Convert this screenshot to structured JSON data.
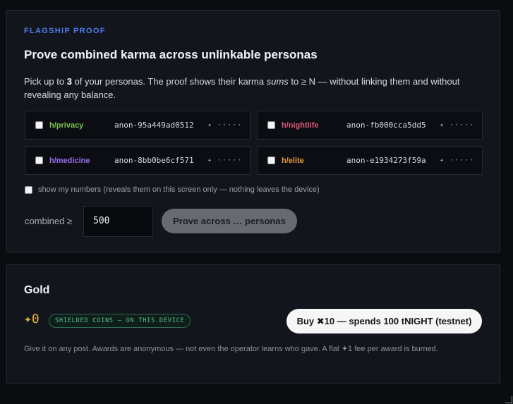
{
  "proof": {
    "eyebrow": "FLAGSHIP PROOF",
    "title": "Prove combined karma across unlinkable personas",
    "desc_before_count": "Pick up to ",
    "desc_count": "3",
    "desc_mid": " of your personas. The proof shows their karma ",
    "desc_sums": "sums",
    "desc_after": " to ≥ N — without linking them and without revealing any balance.",
    "personas": [
      {
        "name": "h/privacy",
        "anon": "anon-95a449ad0512",
        "dots": "✦ ·····",
        "color": "#7cc24a"
      },
      {
        "name": "h/nightlife",
        "anon": "anon-fb000cca5dd5",
        "dots": "✦ ·····",
        "color": "#e0567a"
      },
      {
        "name": "h/medicine",
        "anon": "anon-8bb0be6cf571",
        "dots": "✦ ·····",
        "color": "#9a6ef0"
      },
      {
        "name": "h/elite",
        "anon": "anon-e1934273f59a",
        "dots": "✦ ·····",
        "color": "#e59a3a"
      }
    ],
    "show_numbers_label": "show my numbers (reveals them on this screen only — nothing leaves the device)",
    "combined_label": "combined ≥",
    "threshold_value": "500",
    "prove_button": "Prove across … personas"
  },
  "gold": {
    "title": "Gold",
    "balance": "✦0",
    "badge": "SHIELDED COINS — ON THIS DEVICE",
    "buy_button": "Buy ✖10 — spends 100 tNIGHT (testnet)",
    "note": "Give it on any post. Awards are anonymous — not even the operator learns who gave. A flat ✦1 fee per award is burned."
  }
}
